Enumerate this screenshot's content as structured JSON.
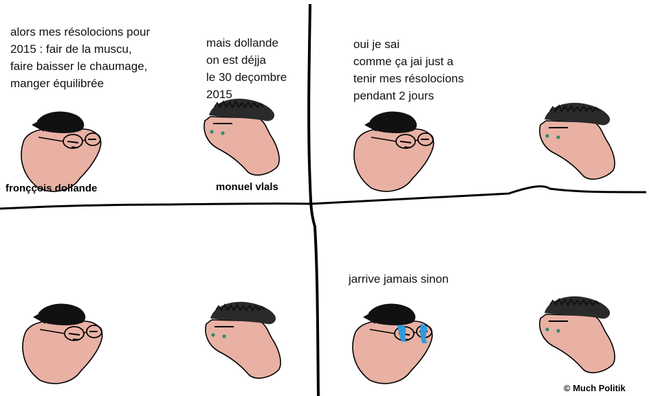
{
  "panels": [
    {
      "text_left": "alors mes résolocions pour\n2015 : fair de la muscu,\nfaire baisser le chaumage,\nmanger équilibrée",
      "text_right": "mais dollande\non est déjja\nle 30 deçombre\n2015",
      "label_left": "fronççois dollande",
      "label_right": "monuel vlals"
    },
    {
      "text": "oui je sai\ncomme ça jai just a\ntenir mes résolocions\npendant 2 jours"
    },
    {},
    {
      "text": "jarrive jamais sinon"
    }
  ],
  "credit": "© Much Politik",
  "colors": {
    "skin": "#E8B1A4",
    "hair": "#111111",
    "tears": "#2E9BDB",
    "eye": "#2E8A6E",
    "ink": "#000000"
  }
}
